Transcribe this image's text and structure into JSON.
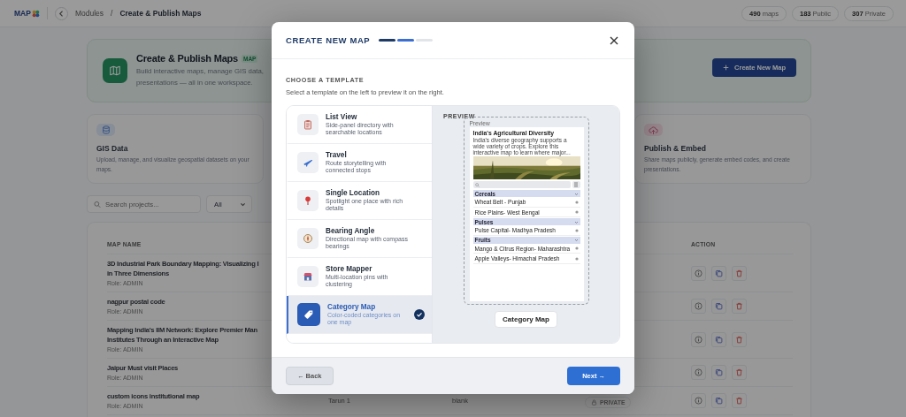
{
  "top_bar": {
    "logo": "MAP",
    "breadcrumb": [
      "Modules",
      "Create & Publish Maps"
    ],
    "separator": "/",
    "stats": [
      {
        "value": "490",
        "label": "maps"
      },
      {
        "value": "183",
        "label": "Public"
      },
      {
        "value": "307",
        "label": "Private"
      }
    ]
  },
  "hero": {
    "title": "Create & Publish Maps",
    "badge": "MAP",
    "description": [
      "Build interactive maps, manage GIS data,",
      "presentations — all in one workspace."
    ],
    "button": "Create New Map"
  },
  "features": [
    {
      "kind": "database",
      "title": "GIS Data",
      "description": "Upload, manage, and visualize geospatial datasets on your maps."
    },
    {
      "kind": "upload",
      "title": "Publish & Embed",
      "description": "Share maps publicly, generate embed codes, and create presentations."
    }
  ],
  "search": {
    "placeholder": "Search projects...",
    "filter": "All"
  },
  "table": {
    "columns": [
      "MAP NAME",
      "ACTION"
    ],
    "rows": [
      {
        "name": [
          "3D Industrial Park Boundary Mapping: Visualizing I",
          "in Three Dimensions"
        ],
        "role": "Role: ADMIN"
      },
      {
        "name": [
          "nagpur postal code"
        ],
        "role": "Role: ADMIN"
      },
      {
        "name": [
          "Mapping India's IIM Network: Explore Premier Man",
          "Institutes Through an Interactive Map"
        ],
        "role": "Role: ADMIN"
      },
      {
        "name": [
          "Jaipur Must visit Places"
        ],
        "role": "Role: ADMIN"
      },
      {
        "name": [
          "custom icons institutional map"
        ],
        "role": "Role: ADMIN",
        "owner": "Tarun 1",
        "column_3": "blank",
        "visibility": "PRIVATE"
      }
    ]
  },
  "modal": {
    "title": "CREATE NEW MAP",
    "steps": [
      {
        "completed": true,
        "selected": false
      },
      {
        "completed": false,
        "selected": true
      },
      {
        "completed": false,
        "selected": false
      }
    ],
    "section_title": "CHOOSE A TEMPLATE",
    "instruction": "Select a template on the left to preview it on the right.",
    "templates": [
      {
        "kind": "list",
        "title": "List View",
        "description": "Side-panel directory with searchable locations",
        "selected": false
      },
      {
        "kind": "travel",
        "title": "Travel",
        "description": "Route storytelling with connected stops",
        "selected": false
      },
      {
        "kind": "pin",
        "title": "Single Location",
        "description": "Spotlight one place with rich details",
        "selected": false
      },
      {
        "kind": "compass",
        "title": "Bearing Angle",
        "description": "Directional map with compass bearings",
        "selected": false
      },
      {
        "kind": "store",
        "title": "Store Mapper",
        "description": "Multi-location pins with clustering",
        "selected": false
      },
      {
        "kind": "tag",
        "title": "Category Map",
        "description": "Color-coded categories on one map",
        "selected": true
      }
    ],
    "preview": {
      "label": "PREVIEW",
      "mock": {
        "label": "Preview",
        "title": "India's Agricultural Diversity",
        "description": "India's diverse geography supports a wide variety of crops. Explore this interactive map to learn where major...",
        "categories": [
          {
            "name": "Cereals",
            "items": [
              "Wheat Belt - Punjab",
              "Rice Plains- West Bengal"
            ]
          },
          {
            "name": "Pulses",
            "items": [
              "Pulse Capital- Madhya Pradesh"
            ]
          },
          {
            "name": "Fruits",
            "items": [
              "Mango & Citrus Region- Maharashtra",
              "Apple Valleys- Himachal Pradesh"
            ]
          }
        ]
      },
      "caption": "Category Map"
    },
    "back": "← Back",
    "next": "Next →"
  }
}
